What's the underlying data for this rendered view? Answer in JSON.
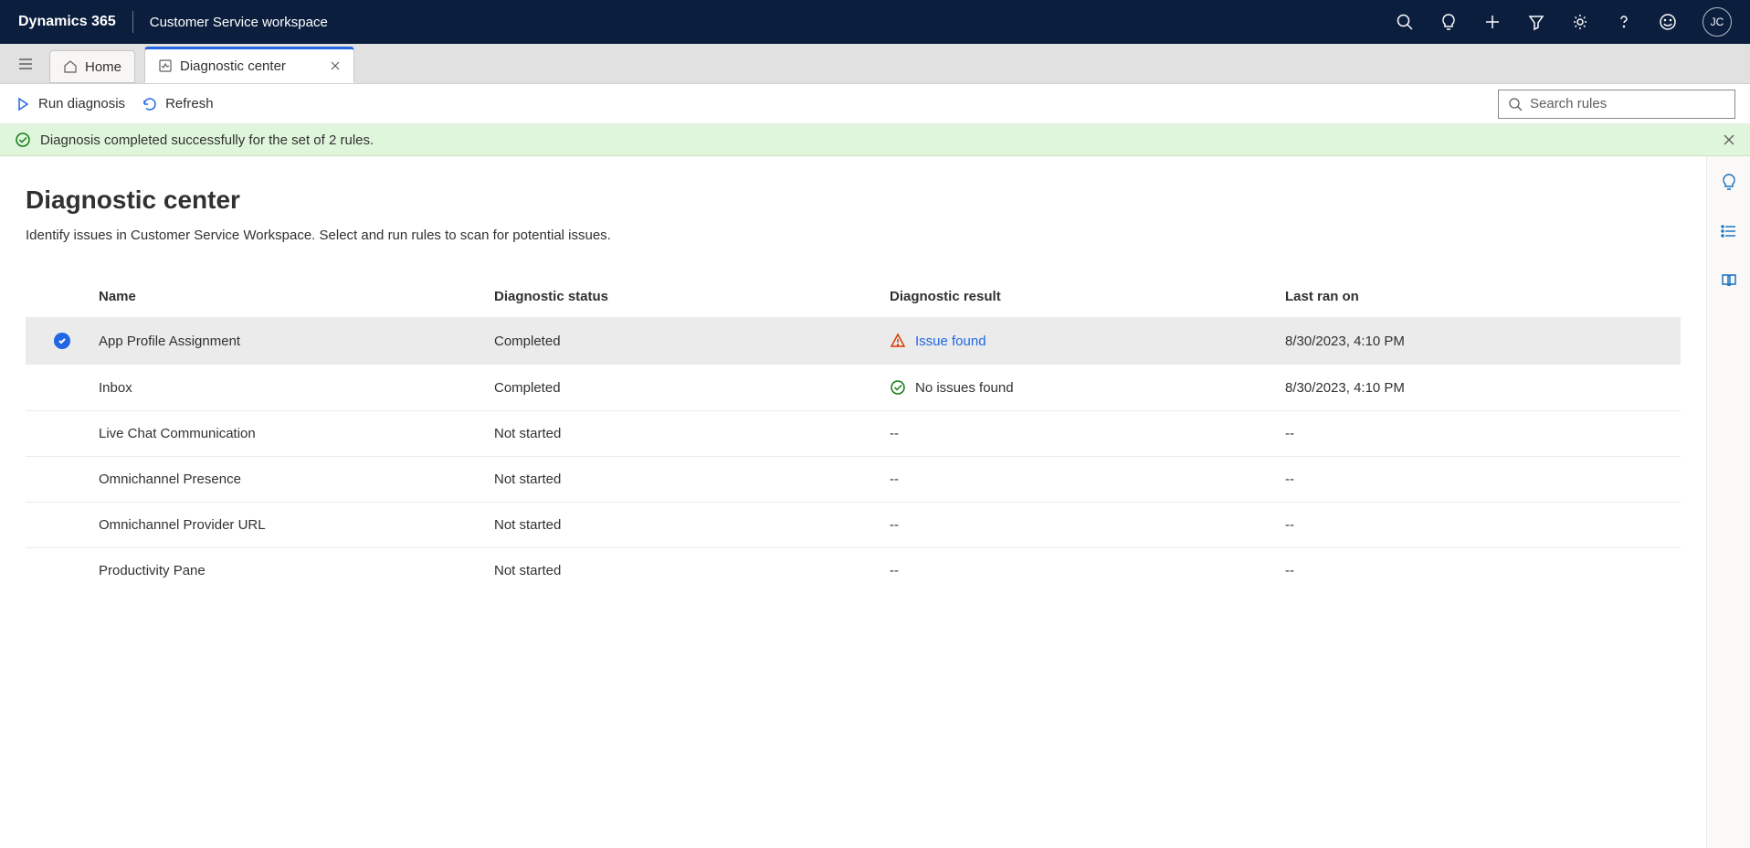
{
  "header": {
    "brand": "Dynamics 365",
    "workspace": "Customer Service workspace",
    "avatar_initials": "JC"
  },
  "tabs": {
    "home_label": "Home",
    "active_label": "Diagnostic center"
  },
  "commands": {
    "run_label": "Run diagnosis",
    "refresh_label": "Refresh",
    "search_placeholder": "Search rules"
  },
  "notification": {
    "text": "Diagnosis completed successfully for the set of 2 rules."
  },
  "page": {
    "title": "Diagnostic center",
    "subtitle": "Identify issues in Customer Service Workspace. Select and run rules to scan for potential issues."
  },
  "table": {
    "columns": {
      "name": "Name",
      "status": "Diagnostic status",
      "result": "Diagnostic result",
      "last_ran": "Last ran on"
    },
    "rows": [
      {
        "selected": true,
        "name": "App Profile Assignment",
        "status": "Completed",
        "result_type": "issue",
        "result_text": "Issue found",
        "last_ran": "8/30/2023, 4:10 PM"
      },
      {
        "selected": false,
        "name": "Inbox",
        "status": "Completed",
        "result_type": "ok",
        "result_text": "No issues found",
        "last_ran": "8/30/2023, 4:10 PM"
      },
      {
        "selected": false,
        "name": "Live Chat Communication",
        "status": "Not started",
        "result_type": "none",
        "result_text": "--",
        "last_ran": "--"
      },
      {
        "selected": false,
        "name": "Omnichannel Presence",
        "status": "Not started",
        "result_type": "none",
        "result_text": "--",
        "last_ran": "--"
      },
      {
        "selected": false,
        "name": "Omnichannel Provider URL",
        "status": "Not started",
        "result_type": "none",
        "result_text": "--",
        "last_ran": "--"
      },
      {
        "selected": false,
        "name": "Productivity Pane",
        "status": "Not started",
        "result_type": "none",
        "result_text": "--",
        "last_ran": "--"
      }
    ]
  }
}
